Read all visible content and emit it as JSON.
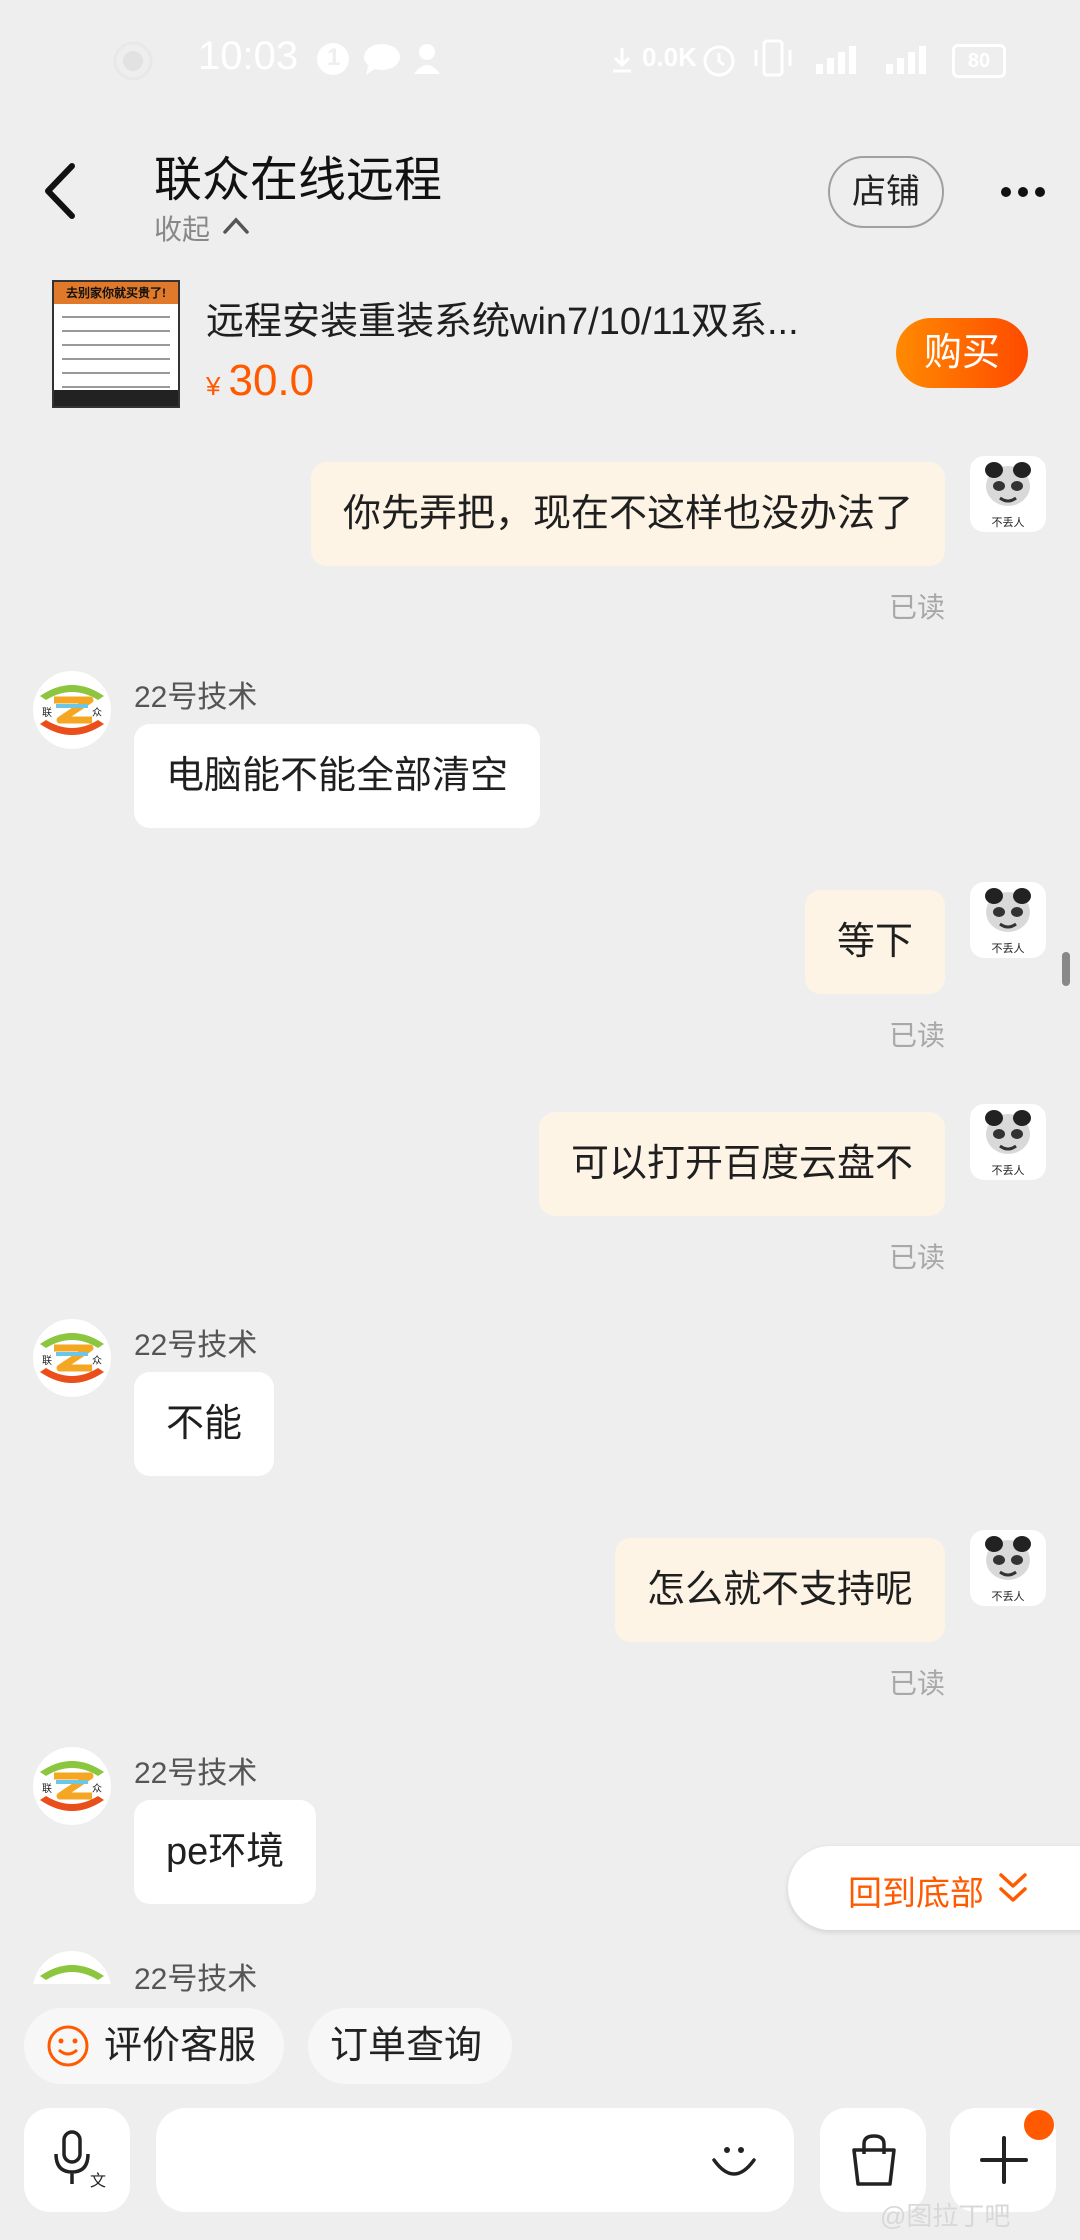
{
  "status_bar": {
    "time": "10:03",
    "notification_count": "1",
    "network_speed": "0.0K",
    "battery": "80"
  },
  "header": {
    "title": "联众在线远程",
    "collapse_label": "收起",
    "shop_button": "店铺"
  },
  "product": {
    "title": "远程安装重装系统win7/10/11双系...",
    "currency": "¥",
    "price": "30.0",
    "buy_button": "购买",
    "image_banner": "去别家你就买贵了!"
  },
  "messages": [
    {
      "from": "me",
      "text": "你先弄把，现在不这样也没办法了",
      "status": "已读"
    },
    {
      "from": "them",
      "sender": "22号技术",
      "text": "电脑能不能全部清空"
    },
    {
      "from": "me",
      "text": "等下",
      "status": "已读"
    },
    {
      "from": "me",
      "text": "可以打开百度云盘不",
      "status": "已读"
    },
    {
      "from": "them",
      "sender": "22号技术",
      "text": "不能"
    },
    {
      "from": "me",
      "text": "怎么就不支持呢",
      "status": "已读"
    },
    {
      "from": "them",
      "sender": "22号技术",
      "text": "pe环境"
    },
    {
      "from": "them",
      "sender": "22号技术",
      "text": ""
    }
  ],
  "avatar_caption": "不丢人",
  "scroll_to_bottom": "回到底部",
  "quick_replies": [
    "评价客服",
    "订单查询"
  ],
  "watermark": "@图拉丁吧",
  "colors": {
    "accent": "#ff5a00",
    "my_bubble": "#fdf4e6",
    "their_bubble": "#ffffff",
    "background": "#eeeeee"
  }
}
